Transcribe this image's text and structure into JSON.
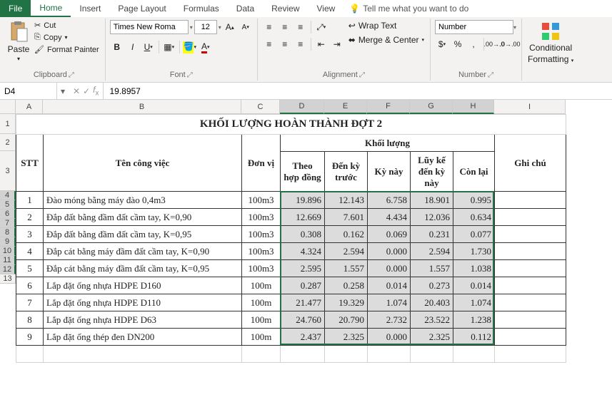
{
  "tabs": [
    "File",
    "Home",
    "Insert",
    "Page Layout",
    "Formulas",
    "Data",
    "Review",
    "View"
  ],
  "tellMe": "Tell me what you want to do",
  "clipboard": {
    "cut": "Cut",
    "copy": "Copy",
    "fmtPainter": "Format Painter",
    "paste": "Paste",
    "label": "Clipboard"
  },
  "font": {
    "name": "Times New Roma",
    "size": "12",
    "label": "Font"
  },
  "alignment": {
    "wrap": "Wrap Text",
    "merge": "Merge & Center",
    "label": "Alignment"
  },
  "number": {
    "fmt": "Number",
    "label": "Number"
  },
  "condFmt": {
    "label1": "Conditional",
    "label2": "Formatting"
  },
  "cell": {
    "ref": "D4",
    "formula": "19.8957"
  },
  "cols": [
    "A",
    "B",
    "C",
    "D",
    "E",
    "F",
    "G",
    "H",
    "I"
  ],
  "rows": [
    "1",
    "2",
    "3",
    "4",
    "5",
    "6",
    "7",
    "8",
    "9",
    "10",
    "11",
    "12",
    "13"
  ],
  "title": "KHỐI LƯỢNG HOÀN THÀNH ĐỢT 2",
  "headers": {
    "stt": "STT",
    "ten": "Tên công việc",
    "dv": "Đơn vị",
    "kl": "Khối lượng",
    "hd": "Theo hợp đồng",
    "truoc": "Đến kỳ trước",
    "kynay": "Kỳ này",
    "luyke": "Lũy kế đến kỳ này",
    "conlai": "Còn lại",
    "ghichu": "Ghi chú"
  },
  "data": [
    {
      "stt": "1",
      "ten": "Đào móng bằng máy đào 0,4m3",
      "dv": "100m3",
      "hd": "19.896",
      "truoc": "12.143",
      "kynay": "6.758",
      "luyke": "18.901",
      "conlai": "0.995"
    },
    {
      "stt": "2",
      "ten": "Đắp đất bằng đầm đất cầm tay, K=0,90",
      "dv": "100m3",
      "hd": "12.669",
      "truoc": "7.601",
      "kynay": "4.434",
      "luyke": "12.036",
      "conlai": "0.634"
    },
    {
      "stt": "3",
      "ten": "Đắp đất bằng đầm đất cầm tay, K=0,95",
      "dv": "100m3",
      "hd": "0.308",
      "truoc": "0.162",
      "kynay": "0.069",
      "luyke": "0.231",
      "conlai": "0.077"
    },
    {
      "stt": "4",
      "ten": "Đắp cát bằng máy đầm đất cầm tay, K=0,90",
      "dv": "100m3",
      "hd": "4.324",
      "truoc": "2.594",
      "kynay": "0.000",
      "luyke": "2.594",
      "conlai": "1.730"
    },
    {
      "stt": "5",
      "ten": "Đắp cát bằng máy đầm đất cầm tay, K=0,95",
      "dv": "100m3",
      "hd": "2.595",
      "truoc": "1.557",
      "kynay": "0.000",
      "luyke": "1.557",
      "conlai": "1.038"
    },
    {
      "stt": "6",
      "ten": "Lắp đặt ống nhựa HDPE D160",
      "dv": "100m",
      "hd": "0.287",
      "truoc": "0.258",
      "kynay": "0.014",
      "luyke": "0.273",
      "conlai": "0.014"
    },
    {
      "stt": "7",
      "ten": "Lắp đặt ống nhựa HDPE D110",
      "dv": "100m",
      "hd": "21.477",
      "truoc": "19.329",
      "kynay": "1.074",
      "luyke": "20.403",
      "conlai": "1.074"
    },
    {
      "stt": "8",
      "ten": "Lắp đặt ống nhựa HDPE D63",
      "dv": "100m",
      "hd": "24.760",
      "truoc": "20.790",
      "kynay": "2.732",
      "luyke": "23.522",
      "conlai": "1.238"
    },
    {
      "stt": "9",
      "ten": "Lắp đặt ống thép đen DN200",
      "dv": "100m",
      "hd": "2.437",
      "truoc": "2.325",
      "kynay": "0.000",
      "luyke": "2.325",
      "conlai": "0.112"
    }
  ]
}
